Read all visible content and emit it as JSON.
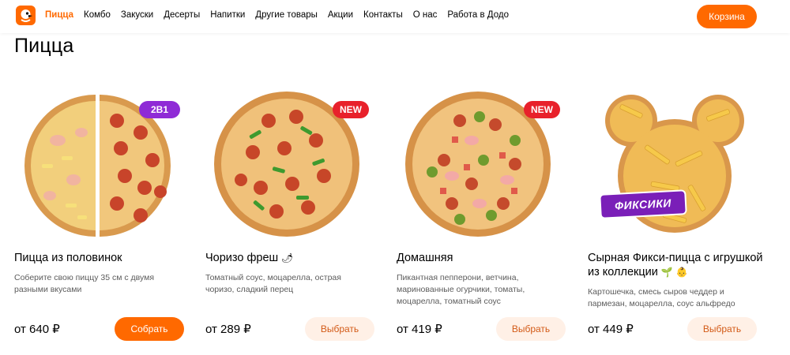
{
  "header": {
    "nav": [
      "Пицца",
      "Комбо",
      "Закуски",
      "Десерты",
      "Напитки",
      "Другие товары",
      "Акции",
      "Контакты",
      "О нас",
      "Работа в Додо"
    ],
    "cart_label": "Корзина"
  },
  "page": {
    "title": "Пицца"
  },
  "products": [
    {
      "name": "Пицца из половинок",
      "description": "Соберите свою пиццу 35 см с двумя разными вкусами",
      "price": "от 640 ₽",
      "button": "Собрать",
      "badge": "2В1"
    },
    {
      "name": "Чоризо фреш",
      "description": "Томатный соус, моцарелла, острая чоризо, сладкий перец",
      "price": "от 289 ₽",
      "button": "Выбрать",
      "badge": "NEW"
    },
    {
      "name": "Домашняя",
      "description": "Пикантная пепперони, ветчина, маринованные огурчики, томаты, моцарелла, томатный соус",
      "price": "от 419 ₽",
      "button": "Выбрать",
      "badge": "NEW"
    },
    {
      "name": "Сырная Фикси-пицца с игрушкой из коллекции",
      "description": "Картошечка, смесь сыров чеддер и пармезан, моцарелла, соус альфредо",
      "price": "от 449 ₽",
      "button": "Выбрать",
      "logo_text": "ФИКСИКИ"
    }
  ],
  "colors": {
    "accent": "#ff6900",
    "button_soft_bg": "#fff0e6",
    "button_soft_text": "#d35a17",
    "badge_purple": "#8f2bd6",
    "badge_red": "#e8212b"
  },
  "icons": [
    "dodo-logo-icon",
    "chili-pepper-icon",
    "plant-icon",
    "baby-icon"
  ]
}
